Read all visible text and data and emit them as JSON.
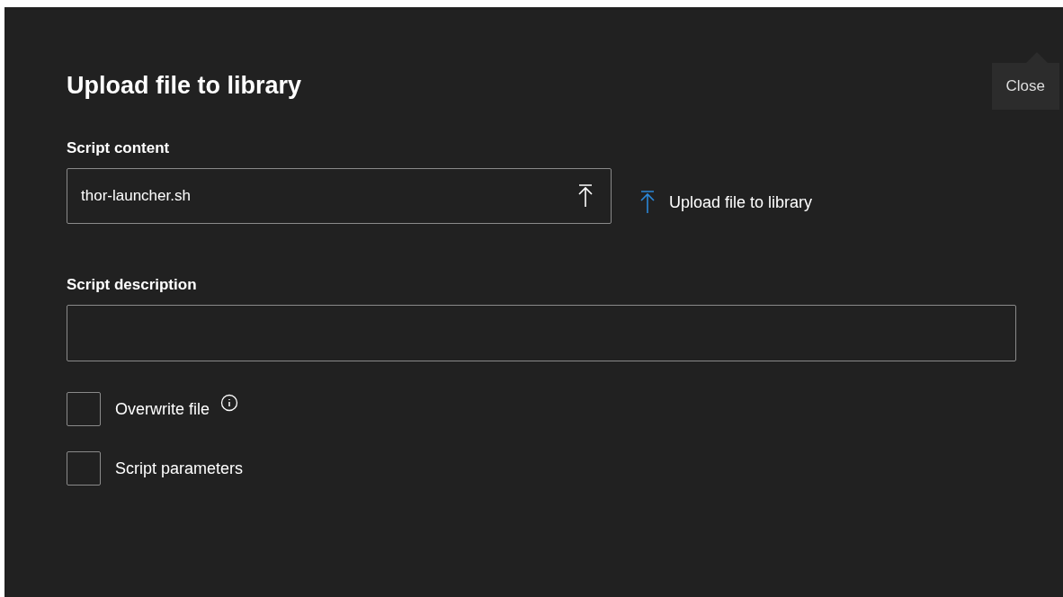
{
  "dialog": {
    "title": "Upload file to library"
  },
  "tooltip": {
    "text": "Close"
  },
  "script_content": {
    "label": "Script content",
    "value": "thor-launcher.sh"
  },
  "upload_link": {
    "label": "Upload file to library"
  },
  "script_description": {
    "label": "Script description"
  },
  "options": [
    {
      "label": "Overwrite file",
      "checked": false,
      "info": true
    },
    {
      "label": "Script parameters",
      "checked": false,
      "info": false
    }
  ]
}
